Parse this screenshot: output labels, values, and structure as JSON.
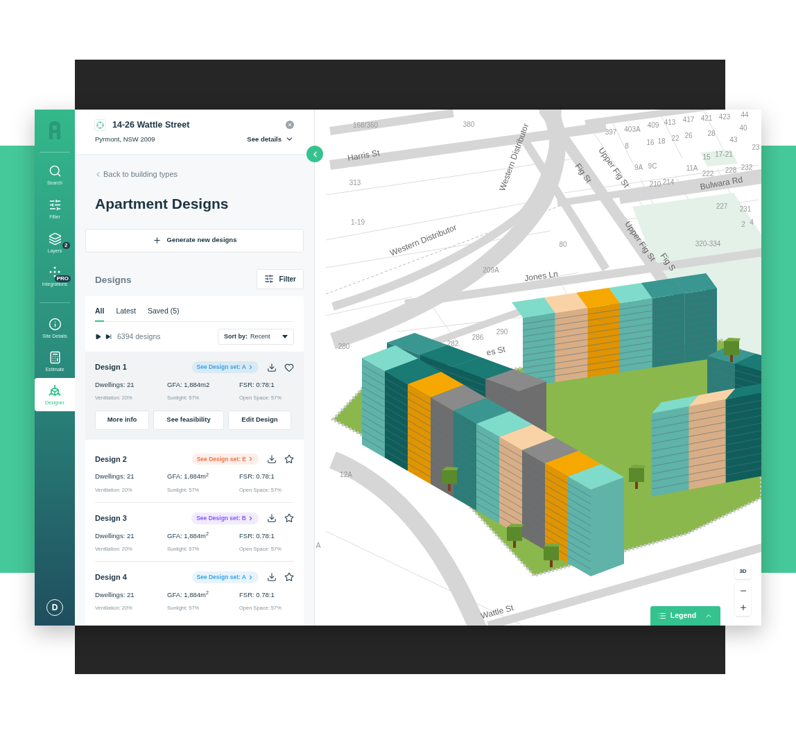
{
  "sidebar": {
    "top_items": [
      {
        "label": "Search",
        "selected": false
      },
      {
        "label": "Filter",
        "selected": false
      },
      {
        "label": "Layers",
        "badge": "2",
        "selected": false
      },
      {
        "label": "Integrations",
        "badge": "PRO",
        "selected": false
      }
    ],
    "bottom_items": [
      {
        "label": "Site Details",
        "selected": false
      },
      {
        "label": "Estimate",
        "selected": false
      },
      {
        "label": "Designer",
        "selected": true
      }
    ],
    "avatar": "D"
  },
  "site": {
    "title": "14-26 Wattle Street",
    "subtitle": "Pyrmont, NSW 2009",
    "details_link": "See details"
  },
  "back_link": "Back to building types",
  "page_title": "Apartment Designs",
  "generate_button": "Generate new designs",
  "designs_heading": "Designs",
  "filter_button": "Filter",
  "tabs": [
    {
      "label": "All",
      "selected": true
    },
    {
      "label": "Latest",
      "selected": false
    },
    {
      "label": "Saved (5)",
      "selected": false
    }
  ],
  "count": "6394 designs",
  "sort": {
    "label": "Sort by:",
    "value": "Recent"
  },
  "designs": [
    {
      "name": "Design 1",
      "tag": "See Design set: A",
      "color": "#3aa6e8",
      "selected": true,
      "stats": [
        "Dwellings: 21",
        "GFA: 1,884m2",
        "FSR: 0:78:1"
      ],
      "metrics": [
        "Ventilation: 20%",
        "Sunlight: 57%",
        "Open Space: 57%"
      ],
      "actions": [
        "More info",
        "See feasibility",
        "Edit Design"
      ]
    },
    {
      "name": "Design 2",
      "tag": "See Design set: E",
      "color": "#f0764a",
      "selected": false,
      "stats": [
        "Dwellings: 21",
        "GFA: 1,884m$^{2}$",
        "FSR: 0.78:1"
      ],
      "metrics": [
        "Ventilation: 20%",
        "Sunlight: 57%",
        "Open Space: 57%"
      ]
    },
    {
      "name": "Design 3",
      "tag": "See Design set: B",
      "color": "#8b5cf6",
      "selected": false,
      "stats": [
        "Dwellings: 21",
        "GFA: 1,884m$^{2}$",
        "FSR: 0.78:1"
      ],
      "metrics": [
        "Ventilation: 20%",
        "Sunlight: 57%",
        "Open Space: 57%"
      ]
    },
    {
      "name": "Design 4",
      "tag": "See Design set: A",
      "color": "#3aa6e8",
      "selected": false,
      "stats": [
        "Dwellings: 21",
        "GFA: 1,884m$^{2}$",
        "FSR: 0.78:1"
      ],
      "metrics": [
        "Ventilation: 20%",
        "Sunlight: 57%",
        "Open Space: 57%"
      ]
    }
  ],
  "map": {
    "labels": [
      {
        "text": "168/360",
        "kind": "lot"
      },
      {
        "text": "380",
        "kind": "lot"
      },
      {
        "text": "Harris St",
        "kind": "street"
      },
      {
        "text": "313",
        "kind": "lot"
      },
      {
        "text": "1-19",
        "kind": "lot"
      },
      {
        "text": "Western Distributor",
        "kind": "street"
      },
      {
        "text": "Western Distributor",
        "kind": "street"
      },
      {
        "text": "209A",
        "kind": "lot"
      },
      {
        "text": "Jones Ln",
        "kind": "street"
      },
      {
        "text": "80",
        "kind": "lot"
      },
      {
        "text": "Fig St",
        "kind": "street"
      },
      {
        "text": "Upper Fig St",
        "kind": "street"
      },
      {
        "text": "Upper Fig St",
        "kind": "street"
      },
      {
        "text": "Fig S",
        "kind": "street"
      },
      {
        "text": "397",
        "kind": "lot"
      },
      {
        "text": "403A",
        "kind": "lot"
      },
      {
        "text": "409",
        "kind": "lot"
      },
      {
        "text": "413",
        "kind": "lot"
      },
      {
        "text": "417",
        "kind": "lot"
      },
      {
        "text": "421",
        "kind": "lot"
      },
      {
        "text": "423",
        "kind": "lot"
      },
      {
        "text": "44",
        "kind": "lot"
      },
      {
        "text": "40",
        "kind": "lot"
      },
      {
        "text": "8",
        "kind": "lot"
      },
      {
        "text": "16",
        "kind": "lot"
      },
      {
        "text": "18",
        "kind": "lot"
      },
      {
        "text": "22",
        "kind": "lot"
      },
      {
        "text": "26",
        "kind": "lot"
      },
      {
        "text": "28",
        "kind": "lot"
      },
      {
        "text": "43",
        "kind": "lot"
      },
      {
        "text": "23",
        "kind": "lot"
      },
      {
        "text": "15",
        "kind": "lot"
      },
      {
        "text": "17-21",
        "kind": "lot"
      },
      {
        "text": "9A",
        "kind": "lot"
      },
      {
        "text": "9C",
        "kind": "lot"
      },
      {
        "text": "11A",
        "kind": "lot"
      },
      {
        "text": "222",
        "kind": "lot"
      },
      {
        "text": "228",
        "kind": "lot"
      },
      {
        "text": "232",
        "kind": "lot"
      },
      {
        "text": "210",
        "kind": "lot"
      },
      {
        "text": "214",
        "kind": "lot"
      },
      {
        "text": "Bulwara Rd",
        "kind": "street"
      },
      {
        "text": "227",
        "kind": "lot"
      },
      {
        "text": "231",
        "kind": "lot"
      },
      {
        "text": "2",
        "kind": "lot"
      },
      {
        "text": "4",
        "kind": "lot"
      },
      {
        "text": "320-334",
        "kind": "lot"
      },
      {
        "text": "280",
        "kind": "lot"
      },
      {
        "text": "282",
        "kind": "lot"
      },
      {
        "text": "286",
        "kind": "lot"
      },
      {
        "text": "290",
        "kind": "lot"
      },
      {
        "text": "es St",
        "kind": "street"
      },
      {
        "text": "12A",
        "kind": "lot"
      },
      {
        "text": "A",
        "kind": "lot"
      },
      {
        "text": "Wattle St",
        "kind": "street"
      }
    ],
    "view_button": "3D",
    "legend_button": "Legend"
  }
}
